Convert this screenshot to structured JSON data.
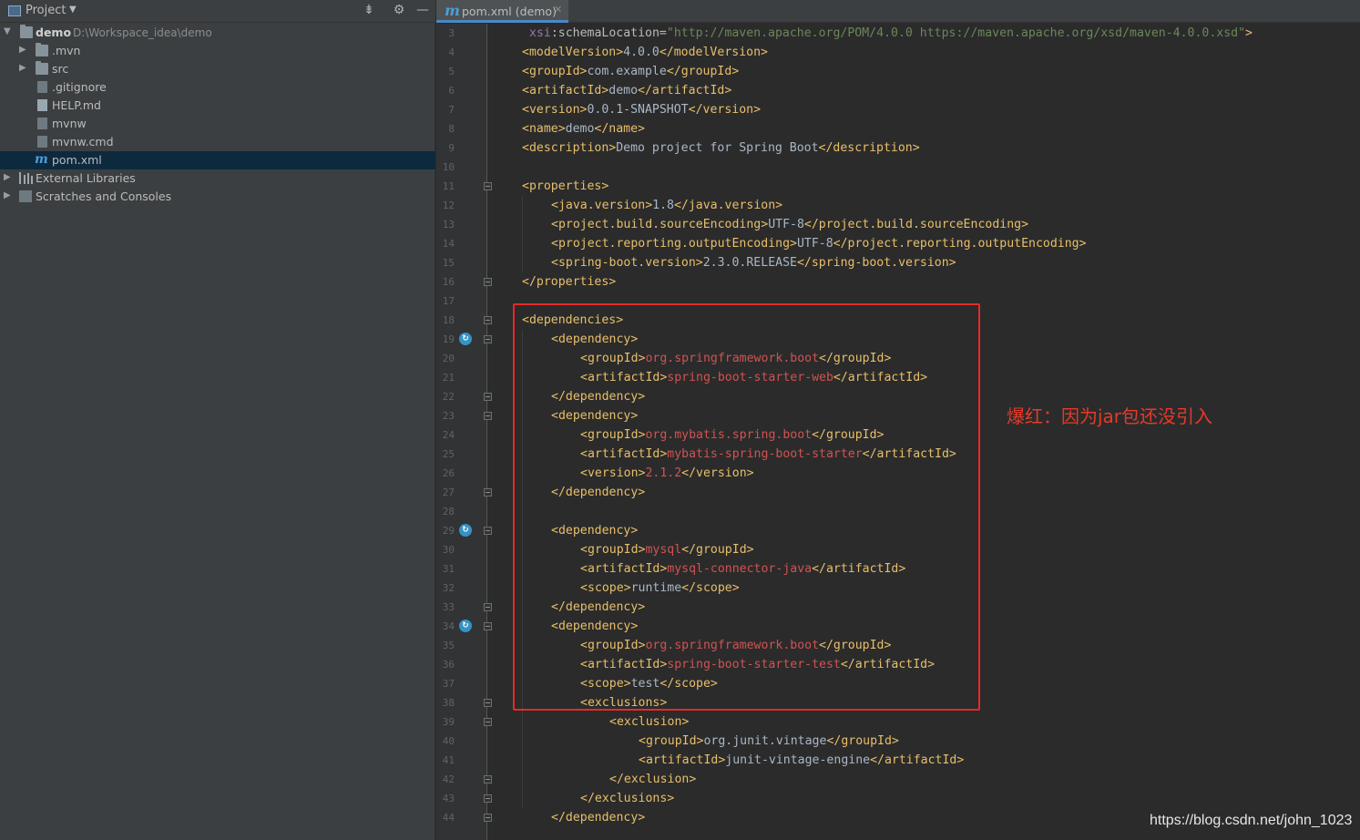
{
  "project_panel": {
    "title": "Project",
    "tree": [
      {
        "label": "demo",
        "path": "D:\\Workspace_idea\\demo"
      },
      {
        "label": ".mvn"
      },
      {
        "label": "src"
      },
      {
        "label": ".gitignore"
      },
      {
        "label": "HELP.md"
      },
      {
        "label": "mvnw"
      },
      {
        "label": "mvnw.cmd"
      },
      {
        "label": "pom.xml",
        "selected": true
      },
      {
        "label": "External Libraries"
      },
      {
        "label": "Scratches and Consoles"
      }
    ]
  },
  "editor": {
    "tab_label": "pom.xml (demo)",
    "line_numbers": [
      "3",
      "4",
      "5",
      "6",
      "7",
      "8",
      "9",
      "10",
      "11",
      "12",
      "13",
      "14",
      "15",
      "16",
      "17",
      "18",
      "19",
      "20",
      "21",
      "22",
      "23",
      "24",
      "25",
      "26",
      "27",
      "28",
      "29",
      "30",
      "31",
      "32",
      "33",
      "34",
      "35",
      "36",
      "37",
      "38",
      "39",
      "40",
      "41",
      "42",
      "43",
      "44"
    ],
    "lines": [
      [
        {
          "t": "xsi",
          "c": "ns"
        },
        {
          "t": ":schemaLocation=",
          "c": "attr"
        },
        {
          "t": "\"http://maven.apache.org/POM/4.0.0 https://maven.apache.org/xsd/maven-4.0.0.xsd\"",
          "c": "val"
        },
        {
          "t": ">",
          "c": "tag"
        }
      ],
      [
        {
          "t": "<modelVersion>",
          "c": "tag"
        },
        {
          "t": "4.0.0",
          "c": "txt"
        },
        {
          "t": "</modelVersion>",
          "c": "tag"
        }
      ],
      [
        {
          "t": "<groupId>",
          "c": "tag"
        },
        {
          "t": "com.example",
          "c": "txt"
        },
        {
          "t": "</groupId>",
          "c": "tag"
        }
      ],
      [
        {
          "t": "<artifactId>",
          "c": "tag"
        },
        {
          "t": "demo",
          "c": "txt"
        },
        {
          "t": "</artifactId>",
          "c": "tag"
        }
      ],
      [
        {
          "t": "<version>",
          "c": "tag"
        },
        {
          "t": "0.0.1-SNAPSHOT",
          "c": "txt"
        },
        {
          "t": "</version>",
          "c": "tag"
        }
      ],
      [
        {
          "t": "<name>",
          "c": "tag"
        },
        {
          "t": "demo",
          "c": "txt"
        },
        {
          "t": "</name>",
          "c": "tag"
        }
      ],
      [
        {
          "t": "<description>",
          "c": "tag"
        },
        {
          "t": "Demo project for Spring Boot",
          "c": "txt"
        },
        {
          "t": "</description>",
          "c": "tag"
        }
      ],
      [],
      [
        {
          "t": "<properties>",
          "c": "tag"
        }
      ],
      [
        {
          "t": "<java.version>",
          "c": "tag"
        },
        {
          "t": "1.8",
          "c": "txt"
        },
        {
          "t": "</java.version>",
          "c": "tag"
        }
      ],
      [
        {
          "t": "<project.build.sourceEncoding>",
          "c": "tag"
        },
        {
          "t": "UTF-8",
          "c": "txt"
        },
        {
          "t": "</project.build.sourceEncoding>",
          "c": "tag"
        }
      ],
      [
        {
          "t": "<project.reporting.outputEncoding>",
          "c": "tag"
        },
        {
          "t": "UTF-8",
          "c": "txt"
        },
        {
          "t": "</project.reporting.outputEncoding>",
          "c": "tag"
        }
      ],
      [
        {
          "t": "<spring-boot.version>",
          "c": "tag"
        },
        {
          "t": "2.3.0.RELEASE",
          "c": "txt"
        },
        {
          "t": "</spring-boot.version>",
          "c": "tag"
        }
      ],
      [
        {
          "t": "</properties>",
          "c": "tag"
        }
      ],
      [],
      [
        {
          "t": "<dependencies>",
          "c": "tag"
        }
      ],
      [
        {
          "t": "<dependency>",
          "c": "tag"
        }
      ],
      [
        {
          "t": "<groupId>",
          "c": "tag"
        },
        {
          "t": "org.springframework.boot",
          "c": "err"
        },
        {
          "t": "</groupId>",
          "c": "tag"
        }
      ],
      [
        {
          "t": "<artifactId>",
          "c": "tag"
        },
        {
          "t": "spring-boot-starter-web",
          "c": "err"
        },
        {
          "t": "</artifactId>",
          "c": "tag"
        }
      ],
      [
        {
          "t": "</dependency>",
          "c": "tag"
        }
      ],
      [
        {
          "t": "<dependency>",
          "c": "tag"
        }
      ],
      [
        {
          "t": "<groupId>",
          "c": "tag"
        },
        {
          "t": "org.mybatis.spring.boot",
          "c": "err"
        },
        {
          "t": "</groupId>",
          "c": "tag"
        }
      ],
      [
        {
          "t": "<artifactId>",
          "c": "tag"
        },
        {
          "t": "mybatis-spring-boot-starter",
          "c": "err"
        },
        {
          "t": "</artifactId>",
          "c": "tag"
        }
      ],
      [
        {
          "t": "<version>",
          "c": "tag"
        },
        {
          "t": "2.1.2",
          "c": "err"
        },
        {
          "t": "</version>",
          "c": "tag"
        }
      ],
      [
        {
          "t": "</dependency>",
          "c": "tag"
        }
      ],
      [],
      [
        {
          "t": "<dependency>",
          "c": "tag"
        }
      ],
      [
        {
          "t": "<groupId>",
          "c": "tag"
        },
        {
          "t": "mysql",
          "c": "err"
        },
        {
          "t": "</groupId>",
          "c": "tag"
        }
      ],
      [
        {
          "t": "<artifactId>",
          "c": "tag"
        },
        {
          "t": "mysql-connector-java",
          "c": "err"
        },
        {
          "t": "</artifactId>",
          "c": "tag"
        }
      ],
      [
        {
          "t": "<scope>",
          "c": "tag"
        },
        {
          "t": "runtime",
          "c": "txt"
        },
        {
          "t": "</scope>",
          "c": "tag"
        }
      ],
      [
        {
          "t": "</dependency>",
          "c": "tag"
        }
      ],
      [
        {
          "t": "<dependency>",
          "c": "tag"
        }
      ],
      [
        {
          "t": "<groupId>",
          "c": "tag"
        },
        {
          "t": "org.springframework.boot",
          "c": "err"
        },
        {
          "t": "</groupId>",
          "c": "tag"
        }
      ],
      [
        {
          "t": "<artifactId>",
          "c": "tag"
        },
        {
          "t": "spring-boot-starter-test",
          "c": "err"
        },
        {
          "t": "</artifactId>",
          "c": "tag"
        }
      ],
      [
        {
          "t": "<scope>",
          "c": "tag"
        },
        {
          "t": "test",
          "c": "txt"
        },
        {
          "t": "</scope>",
          "c": "tag"
        }
      ],
      [
        {
          "t": "<exclusions>",
          "c": "tag"
        }
      ],
      [
        {
          "t": "<exclusion>",
          "c": "tag"
        }
      ],
      [
        {
          "t": "<groupId>",
          "c": "tag"
        },
        {
          "t": "org.junit.vintage",
          "c": "txt"
        },
        {
          "t": "</groupId>",
          "c": "tag"
        }
      ],
      [
        {
          "t": "<artifactId>",
          "c": "tag"
        },
        {
          "t": "junit-vintage-engine",
          "c": "txt"
        },
        {
          "t": "</artifactId>",
          "c": "tag"
        }
      ],
      [
        {
          "t": "</exclusion>",
          "c": "tag"
        }
      ],
      [
        {
          "t": "</exclusions>",
          "c": "tag"
        }
      ],
      [
        {
          "t": "</dependency>",
          "c": "tag"
        }
      ]
    ]
  },
  "annotation": {
    "text": "爆红：因为jar包还没引入",
    "color": "#e53a2a"
  },
  "watermark": "https://blog.csdn.net/john_1023",
  "colors": {
    "tag": "#e8bf6a",
    "text": "#a9b7c6",
    "unresolved": "#d25252",
    "selection": "#0d293e"
  }
}
